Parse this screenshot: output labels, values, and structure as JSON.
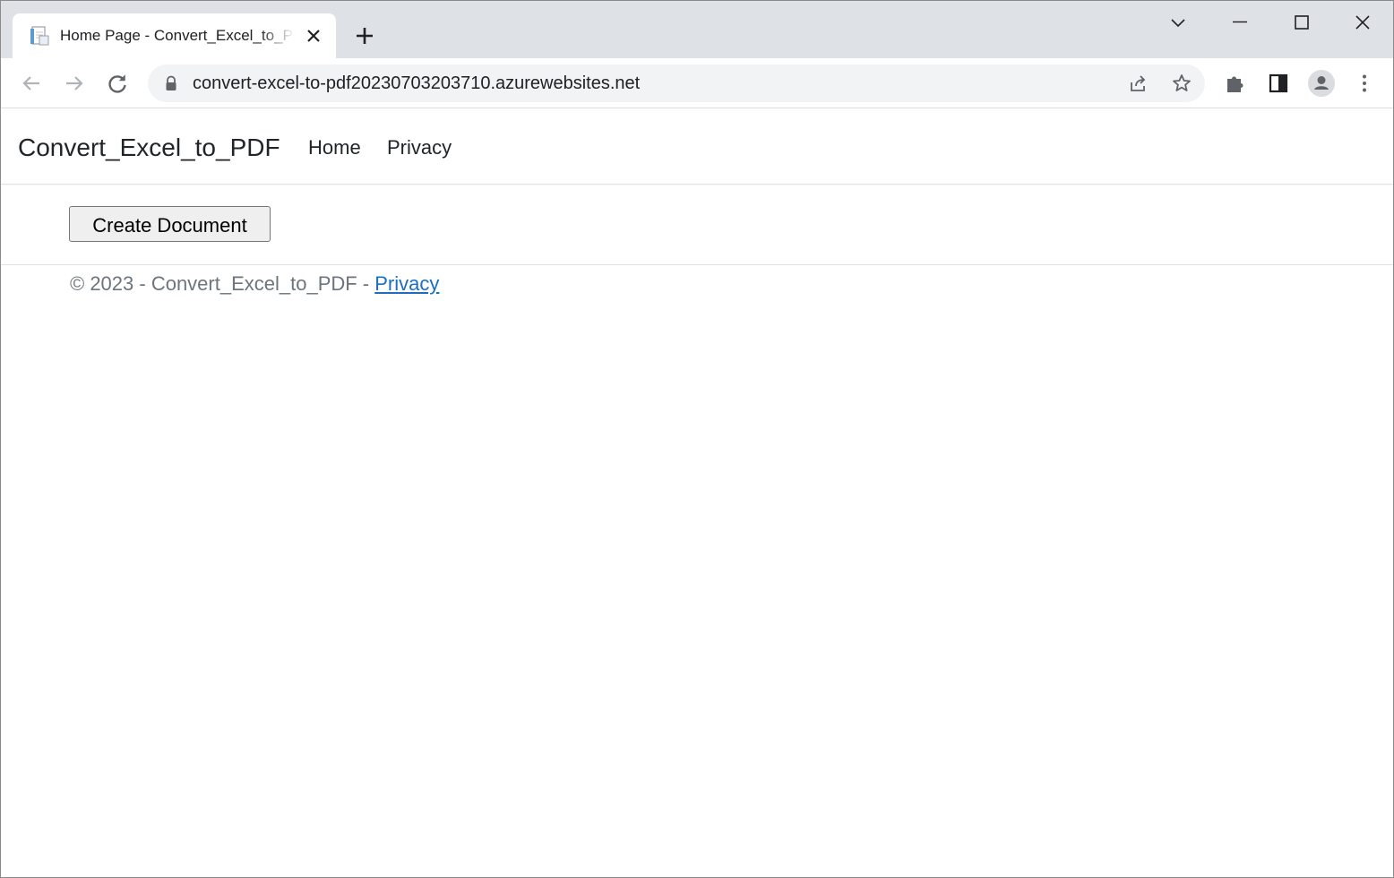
{
  "browser": {
    "tab_title": "Home Page - Convert_Excel_to_PDF",
    "url": "convert-excel-to-pdf20230703203710.azurewebsites.net"
  },
  "site": {
    "brand": "Convert_Excel_to_PDF",
    "nav": [
      {
        "label": "Home"
      },
      {
        "label": "Privacy"
      }
    ],
    "create_button": "Create Document",
    "footer": {
      "prefix": "© 2023 - Convert_Excel_to_PDF - ",
      "link": "Privacy"
    }
  },
  "colors": {
    "tabstrip": "#dee1e6",
    "omnibox": "#f1f3f4",
    "link": "#1b6ec2",
    "footer_text": "#6c757d"
  }
}
